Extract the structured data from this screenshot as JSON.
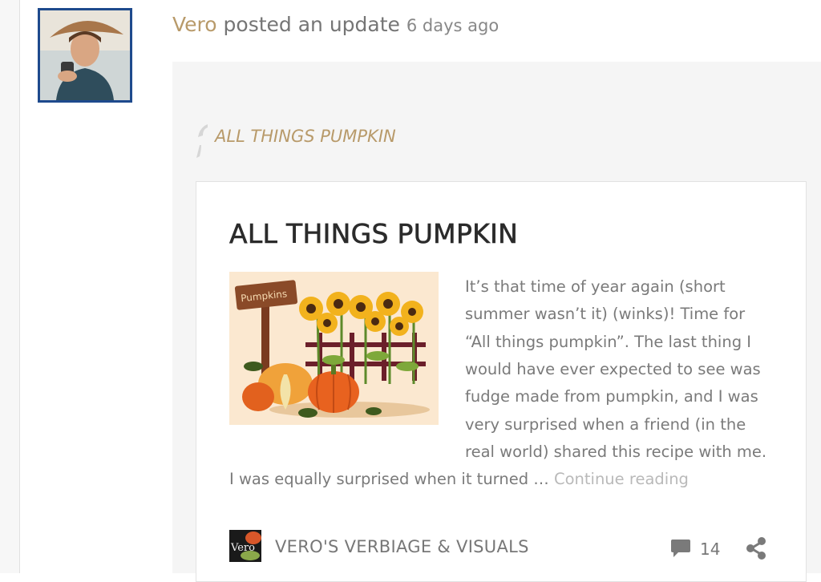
{
  "post": {
    "author": "Vero",
    "action": "posted an update",
    "time": "6 days ago"
  },
  "shared": {
    "title": "ALL THINGS PUMPKIN"
  },
  "card": {
    "title": "ALL THINGS PUMPKIN",
    "image_sign_text": "Pumpkins",
    "excerpt_lines": [
      "It’s that time of year again (short",
      "summer wasn’t it) (winks)! Time for",
      "“All things pumpkin”. The last thing I",
      "would have ever expected to see was",
      "fudge made from pumpkin, and I was",
      "very surprised when a friend (in the",
      "real world) shared this recipe with me.",
      "I was equally surprised when it turned …"
    ],
    "continue_label": "Continue reading"
  },
  "footer": {
    "logo_text": "Vero",
    "site_name": "VERO'S VERBIAGE & VISUALS",
    "comment_count": "14"
  },
  "colors": {
    "accent": "#b89a6a",
    "avatar_border": "#1e4a8d"
  },
  "icons": {
    "comment": "comment-bubble-icon",
    "share": "share-icon",
    "quote": "quote-icon"
  }
}
